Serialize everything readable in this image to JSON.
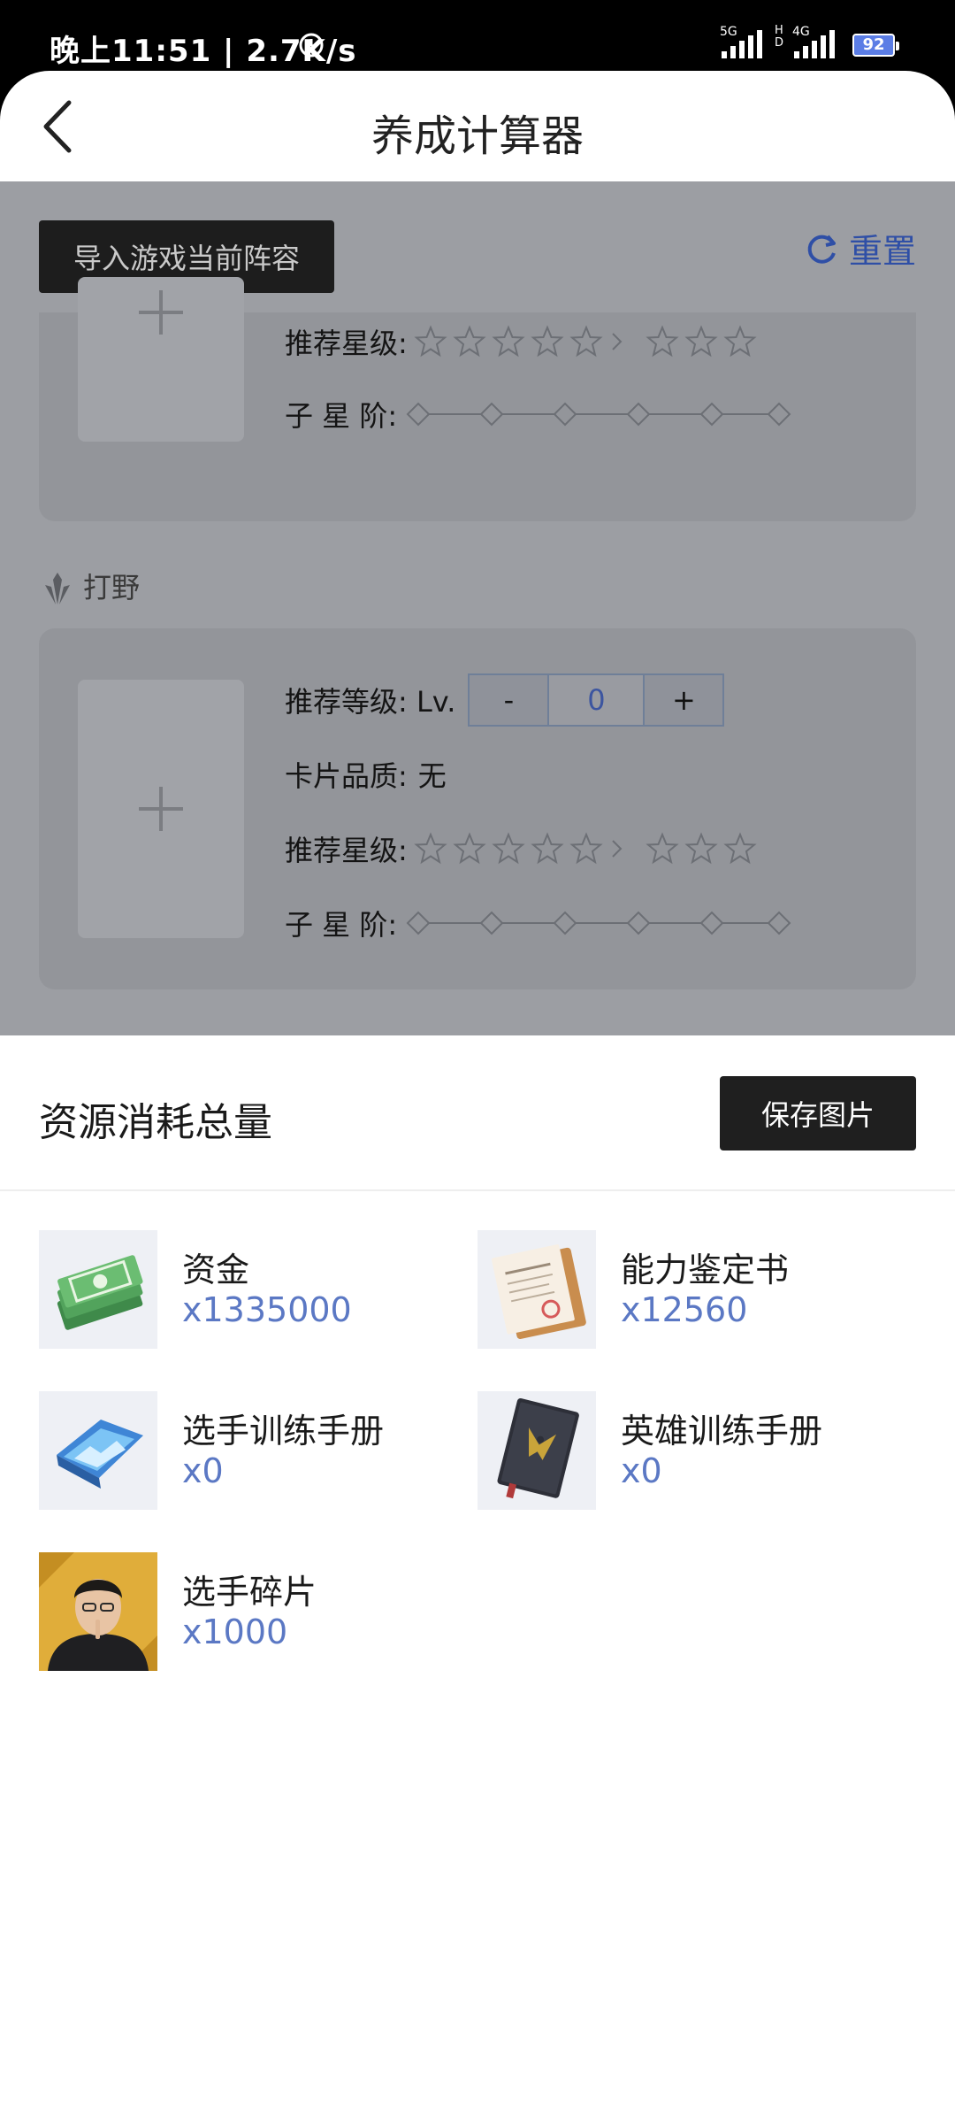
{
  "status_bar": {
    "time": "晚上11:51 | 2.7K/s",
    "network_5g": "5G",
    "network_hd": "HD",
    "network_4g": "4G",
    "battery": "92"
  },
  "header": {
    "title": "养成计算器"
  },
  "calculator": {
    "import_button": "导入游戏当前阵容",
    "reset_label": "重置",
    "card1": {
      "star_label": "推荐星级:",
      "sub_star_label": "子 星 阶:"
    },
    "section_jungle": "打野",
    "card2": {
      "level_label": "推荐等级: Lv.",
      "level_minus": "-",
      "level_value": "0",
      "level_plus": "+",
      "quality_label": "卡片品质:",
      "quality_value": "无",
      "star_label": "推荐星级:",
      "sub_star_label": "子 星 阶:"
    }
  },
  "sheet": {
    "title": "资源消耗总量",
    "save_button": "保存图片",
    "resources": [
      {
        "name": "资金",
        "qty": "x1335000",
        "icon": "money-icon"
      },
      {
        "name": "能力鉴定书",
        "qty": "x12560",
        "icon": "certificate-icon"
      },
      {
        "name": "选手训练手册",
        "qty": "x0",
        "icon": "player-manual-icon"
      },
      {
        "name": "英雄训练手册",
        "qty": "x0",
        "icon": "hero-manual-icon"
      },
      {
        "name": "选手碎片",
        "qty": "x1000",
        "icon": "player-shard-icon"
      }
    ]
  },
  "colors": {
    "accent_blue": "#5b78c4",
    "overlay_gray": "#9c9ea3",
    "button_dark": "#1f1f1f"
  }
}
